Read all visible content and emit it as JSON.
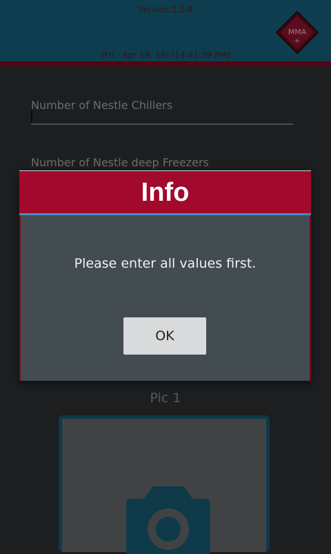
{
  "header": {
    "version": "Version:1.5.4",
    "datetime": "(Fri - Apr 19, 19) (14:41:39 PM)",
    "logo_text": "MMA",
    "logo_plus": "+"
  },
  "form": {
    "chillers_label": "Number of Nestle Chillers",
    "chillers_value": "",
    "freezers_label": "Number of Nestle deep Freezers"
  },
  "picture": {
    "label": "Pic 1",
    "icon": "camera-icon"
  },
  "dialog": {
    "title": "Info",
    "message": "Please enter all values first.",
    "ok_label": "OK"
  },
  "colors": {
    "header_bg": "#0d3d4e",
    "dialog_title_bg": "#a2092c",
    "dialog_body_bg": "#434c50",
    "accent_blue": "#3f8fc0"
  }
}
